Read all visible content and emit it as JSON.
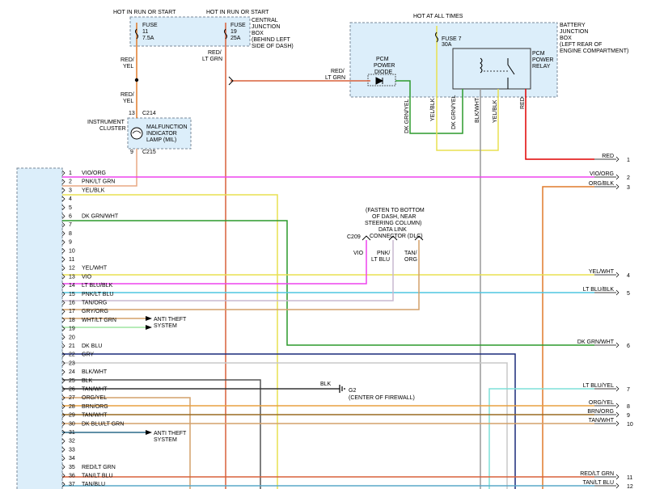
{
  "colors": {
    "vio": "#ee44ee",
    "pnk": "#e8a883",
    "yel": "#e8e050",
    "dkgrn": "#2c9a2c",
    "ltblu": "#4fc6e0",
    "tan": "#d4a06a",
    "gry": "#c8c8c8",
    "wht": "#9ee6a0",
    "dkblu": "#1a2a7a",
    "blk": "#333333",
    "red": "#e00000",
    "org": "#e07a2a",
    "brn": "#9a6a20",
    "redltgrn": "#d9603a",
    "box": "#dceefa"
  },
  "top": {
    "hot_run_start_1": "HOT IN RUN OR START",
    "hot_run_start_2": "HOT IN RUN OR START",
    "hot_at_all_times": "HOT AT ALL TIMES",
    "fuse11": [
      "FUSE",
      "11",
      "7.5A"
    ],
    "fuse19": [
      "FUSE",
      "19",
      "25A"
    ],
    "cjb": [
      "CENTRAL",
      "JUNCTION",
      "BOX",
      "(BEHIND LEFT",
      "SIDE OF DASH)"
    ],
    "fuse7": [
      "FUSE 7",
      "30A"
    ],
    "bjb": [
      "BATTERY",
      "JUNCTION",
      "BOX",
      "(LEFT REAR OF",
      "ENGINE COMPARTMENT)"
    ],
    "pcm_diode": [
      "PCM",
      "POWER",
      "DIODE"
    ],
    "pcm_relay": [
      "PCM",
      "POWER",
      "RELAY"
    ],
    "red_yel_1": [
      "RED/",
      "YEL"
    ],
    "red_yel_2": [
      "RED/",
      "YEL"
    ],
    "red_ltgrn_1": [
      "RED/",
      "LT GRN"
    ],
    "red_ltgrn_2": [
      "RED/",
      "LT GRN"
    ],
    "c214": "C214",
    "c215": "C215",
    "pin13": "13",
    "pin9": "9",
    "cluster": [
      "INSTRUMENT",
      "CLUSTER"
    ],
    "mil": [
      "MALFUNCTION",
      "INDICATOR",
      "LAMP (MIL)"
    ],
    "vlabels": [
      "DK GRN/YEL",
      "YEL/BLK",
      "DK GRN/YEL",
      "BLK/WHT",
      "YEL/BLK",
      "RED"
    ]
  },
  "pcm_pins": [
    {
      "num": "1",
      "label": "VIO/ORG"
    },
    {
      "num": "2",
      "label": "PNK/LT GRN"
    },
    {
      "num": "3",
      "label": "YEL/BLK"
    },
    {
      "num": "4",
      "label": ""
    },
    {
      "num": "5",
      "label": ""
    },
    {
      "num": "6",
      "label": "DK GRN/WHT"
    },
    {
      "num": "7",
      "label": ""
    },
    {
      "num": "8",
      "label": ""
    },
    {
      "num": "9",
      "label": ""
    },
    {
      "num": "10",
      "label": ""
    },
    {
      "num": "11",
      "label": ""
    },
    {
      "num": "12",
      "label": "YEL/WHT"
    },
    {
      "num": "13",
      "label": "VIO"
    },
    {
      "num": "14",
      "label": "LT BLU/BLK"
    },
    {
      "num": "15",
      "label": "PNK/LT BLU"
    },
    {
      "num": "16",
      "label": "TAN/ORG"
    },
    {
      "num": "17",
      "label": "GRY/ORG"
    },
    {
      "num": "18",
      "label": "WHT/LT GRN"
    },
    {
      "num": "19",
      "label": ""
    },
    {
      "num": "20",
      "label": ""
    },
    {
      "num": "21",
      "label": "DK BLU"
    },
    {
      "num": "22",
      "label": "GRY"
    },
    {
      "num": "23",
      "label": ""
    },
    {
      "num": "24",
      "label": "BLK/WHT"
    },
    {
      "num": "25",
      "label": "BLK"
    },
    {
      "num": "26",
      "label": "TAN/WHT"
    },
    {
      "num": "27",
      "label": "ORG/YEL"
    },
    {
      "num": "28",
      "label": "BRN/ORG"
    },
    {
      "num": "29",
      "label": "TAN/WHT"
    },
    {
      "num": "30",
      "label": "DK BLU/LT GRN"
    },
    {
      "num": "31",
      "label": ""
    },
    {
      "num": "32",
      "label": ""
    },
    {
      "num": "33",
      "label": ""
    },
    {
      "num": "34",
      "label": ""
    },
    {
      "num": "35",
      "label": "RED/LT GRN"
    },
    {
      "num": "36",
      "label": "TAN/LT BLU"
    },
    {
      "num": "37",
      "label": "TAN/BLU"
    }
  ],
  "right_ends": [
    {
      "num": "1",
      "label": "RED"
    },
    {
      "num": "2",
      "label": "VIO/ORG"
    },
    {
      "num": "3",
      "label": "ORG/BLK"
    },
    {
      "num": "4",
      "label": "YEL/WHT"
    },
    {
      "num": "5",
      "label": "LT BLU/BLK"
    },
    {
      "num": "6",
      "label": "DK GRN/WHT"
    },
    {
      "num": "7",
      "label": "LT BLU/YEL"
    },
    {
      "num": "8",
      "label": "ORG/YEL"
    },
    {
      "num": "9",
      "label": "BRN/ORG"
    },
    {
      "num": "10",
      "label": "TAN/WHT"
    },
    {
      "num": "11",
      "label": "RED/LT GRN"
    },
    {
      "num": "12",
      "label": "TAN/LT BLU"
    }
  ],
  "dlc": {
    "note": [
      "(FASTEN TO BOTTOM",
      "OF DASH, NEAR",
      "STEERING COLUMN)",
      "DATA LINK",
      "CONNECTOR (DLC)"
    ],
    "c209": "C209",
    "vio": "VIO",
    "pnk_ltblu": [
      "PNK/",
      "LT BLU"
    ],
    "tan_org": [
      "TAN/",
      "ORG"
    ]
  },
  "anti_theft_1": [
    "ANTI THEFT",
    "SYSTEM"
  ],
  "anti_theft_2": [
    "ANTI THEFT",
    "SYSTEM"
  ],
  "ground": {
    "wire": "BLK",
    "name": "G2",
    "loc": "(CENTER OF FIREWALL)"
  },
  "chart_data": {}
}
